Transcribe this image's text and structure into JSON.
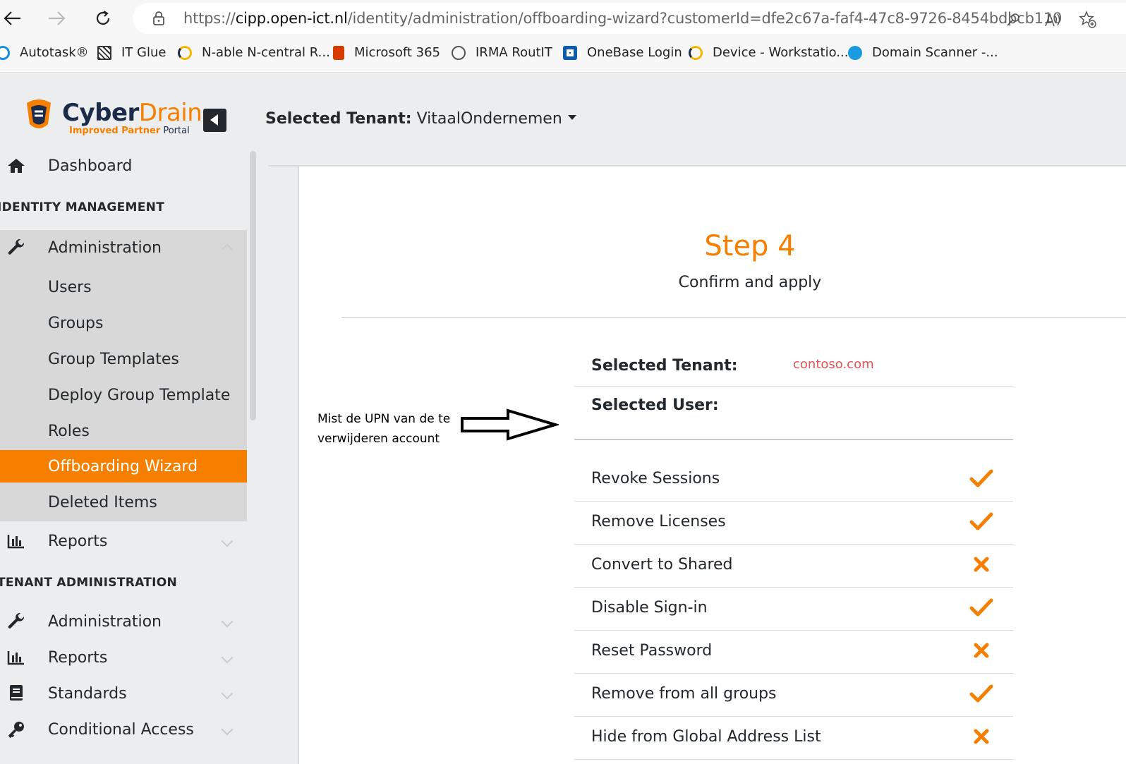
{
  "browser": {
    "url_prefix": "https://",
    "url_host": "cipp.open-ict.nl",
    "url_path": "/identity/administration/offboarding-wizard?customerId=dfe2c67a-faf4-47c8-9726-8454bdbcb110",
    "bookmarks": [
      {
        "label": "Autotask®",
        "icon": "autotask-icon",
        "color": "#1a8fe0"
      },
      {
        "label": "IT Glue",
        "icon": "itglue-icon",
        "color": "#333333"
      },
      {
        "label": "N-able N-central R...",
        "icon": "nable-icon",
        "color": "#f5b800"
      },
      {
        "label": "Microsoft 365",
        "icon": "office-icon",
        "color": "#d83b01"
      },
      {
        "label": "IRMA RoutIT",
        "icon": "irma-icon",
        "color": "#555555"
      },
      {
        "label": "OneBase Login",
        "icon": "onebase-icon",
        "color": "#0b5cad"
      },
      {
        "label": "Device - Workstatio...",
        "icon": "nable-icon",
        "color": "#f5b800"
      },
      {
        "label": "Domain Scanner -...",
        "icon": "domain-scanner-icon",
        "color": "#1a9be0"
      }
    ]
  },
  "brand": {
    "cyber": "Cyber",
    "drain": "Drain",
    "sub_a": "Improved Partner",
    "sub_b": " Portal"
  },
  "header": {
    "tenant_label": "Selected Tenant:",
    "tenant_value": " VitaalOndernemen"
  },
  "sidebar": {
    "dashboard": "Dashboard",
    "section_identity": "IDENTITY MANAGEMENT",
    "identity_admin": "Administration",
    "sub_items": [
      "Users",
      "Groups",
      "Group Templates",
      "Deploy Group Template",
      "Roles",
      "Offboarding Wizard",
      "Deleted Items"
    ],
    "active_sub": "Offboarding Wizard",
    "identity_reports": "Reports",
    "section_tenant": "TENANT ADMINISTRATION",
    "tenant_items": [
      "Administration",
      "Reports",
      "Standards",
      "Conditional Access"
    ]
  },
  "wizard": {
    "step_title": "Step 4",
    "step_subtitle": "Confirm and apply",
    "selected_tenant_label": "Selected Tenant:",
    "selected_tenant_value": "contoso.com",
    "selected_user_label": "Selected User:",
    "selected_user_value": "",
    "options": [
      {
        "label": "Revoke Sessions",
        "enabled": true
      },
      {
        "label": "Remove Licenses",
        "enabled": true
      },
      {
        "label": "Convert to Shared",
        "enabled": false
      },
      {
        "label": "Disable Sign-in",
        "enabled": true
      },
      {
        "label": "Reset Password",
        "enabled": false
      },
      {
        "label": "Remove from all groups",
        "enabled": true
      },
      {
        "label": "Hide from Global Address List",
        "enabled": false
      }
    ]
  },
  "annotation": {
    "line1": "Mist de UPN van de te",
    "line2": "verwijderen account"
  },
  "colors": {
    "accent": "#f77f00",
    "tenant_value": "#e55353"
  }
}
